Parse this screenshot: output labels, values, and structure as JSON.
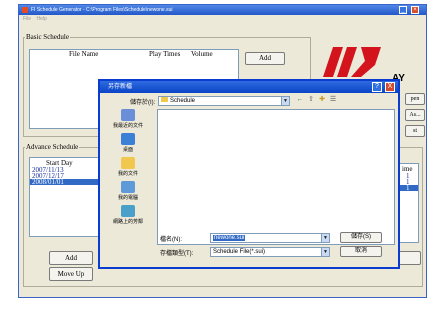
{
  "window": {
    "title": "FI Schedule Generator - C:\\Program Files\\Schedule\\newone.sui",
    "menu": [
      "File",
      "Help"
    ]
  },
  "basic_schedule": {
    "label": "Basic Schedule",
    "columns": [
      "File Name",
      "Play Times",
      "Volume"
    ],
    "add_label": "Add"
  },
  "logo": {
    "brand_color": "#d4141c",
    "partial_text": "AY"
  },
  "right_buttons": [
    "pen",
    "As...",
    "st"
  ],
  "advance_schedule": {
    "label": "Advance Schedule",
    "column": "Start Day",
    "dates": [
      "2007/11/13",
      "2007/12/17",
      "2008/01/01"
    ],
    "selected_index": 2,
    "add_label": "Add",
    "move_up_label": "Move Up"
  },
  "right_list": {
    "header": "ime",
    "rows": [
      "1",
      "1",
      "1"
    ],
    "selected_index": 2
  },
  "dialog": {
    "title": "另存新檔",
    "save_in_label": "儲存於(I):",
    "save_in_value": "Schedule",
    "places": [
      "我最近的文件",
      "桌面",
      "我的文件",
      "我的電腦",
      "網路上的芳鄰"
    ],
    "file_name_label": "檔名(N):",
    "file_name_value": "newone.sui",
    "file_type_label": "存檔類型(T):",
    "file_type_value": "Schedule File(*.sui)",
    "save_button": "儲存(S)",
    "cancel_button": "取消",
    "help_glyph": "?",
    "close_glyph": "X",
    "colors": {
      "title_bar": "#0b44c7",
      "selection": "#316ac5"
    }
  }
}
